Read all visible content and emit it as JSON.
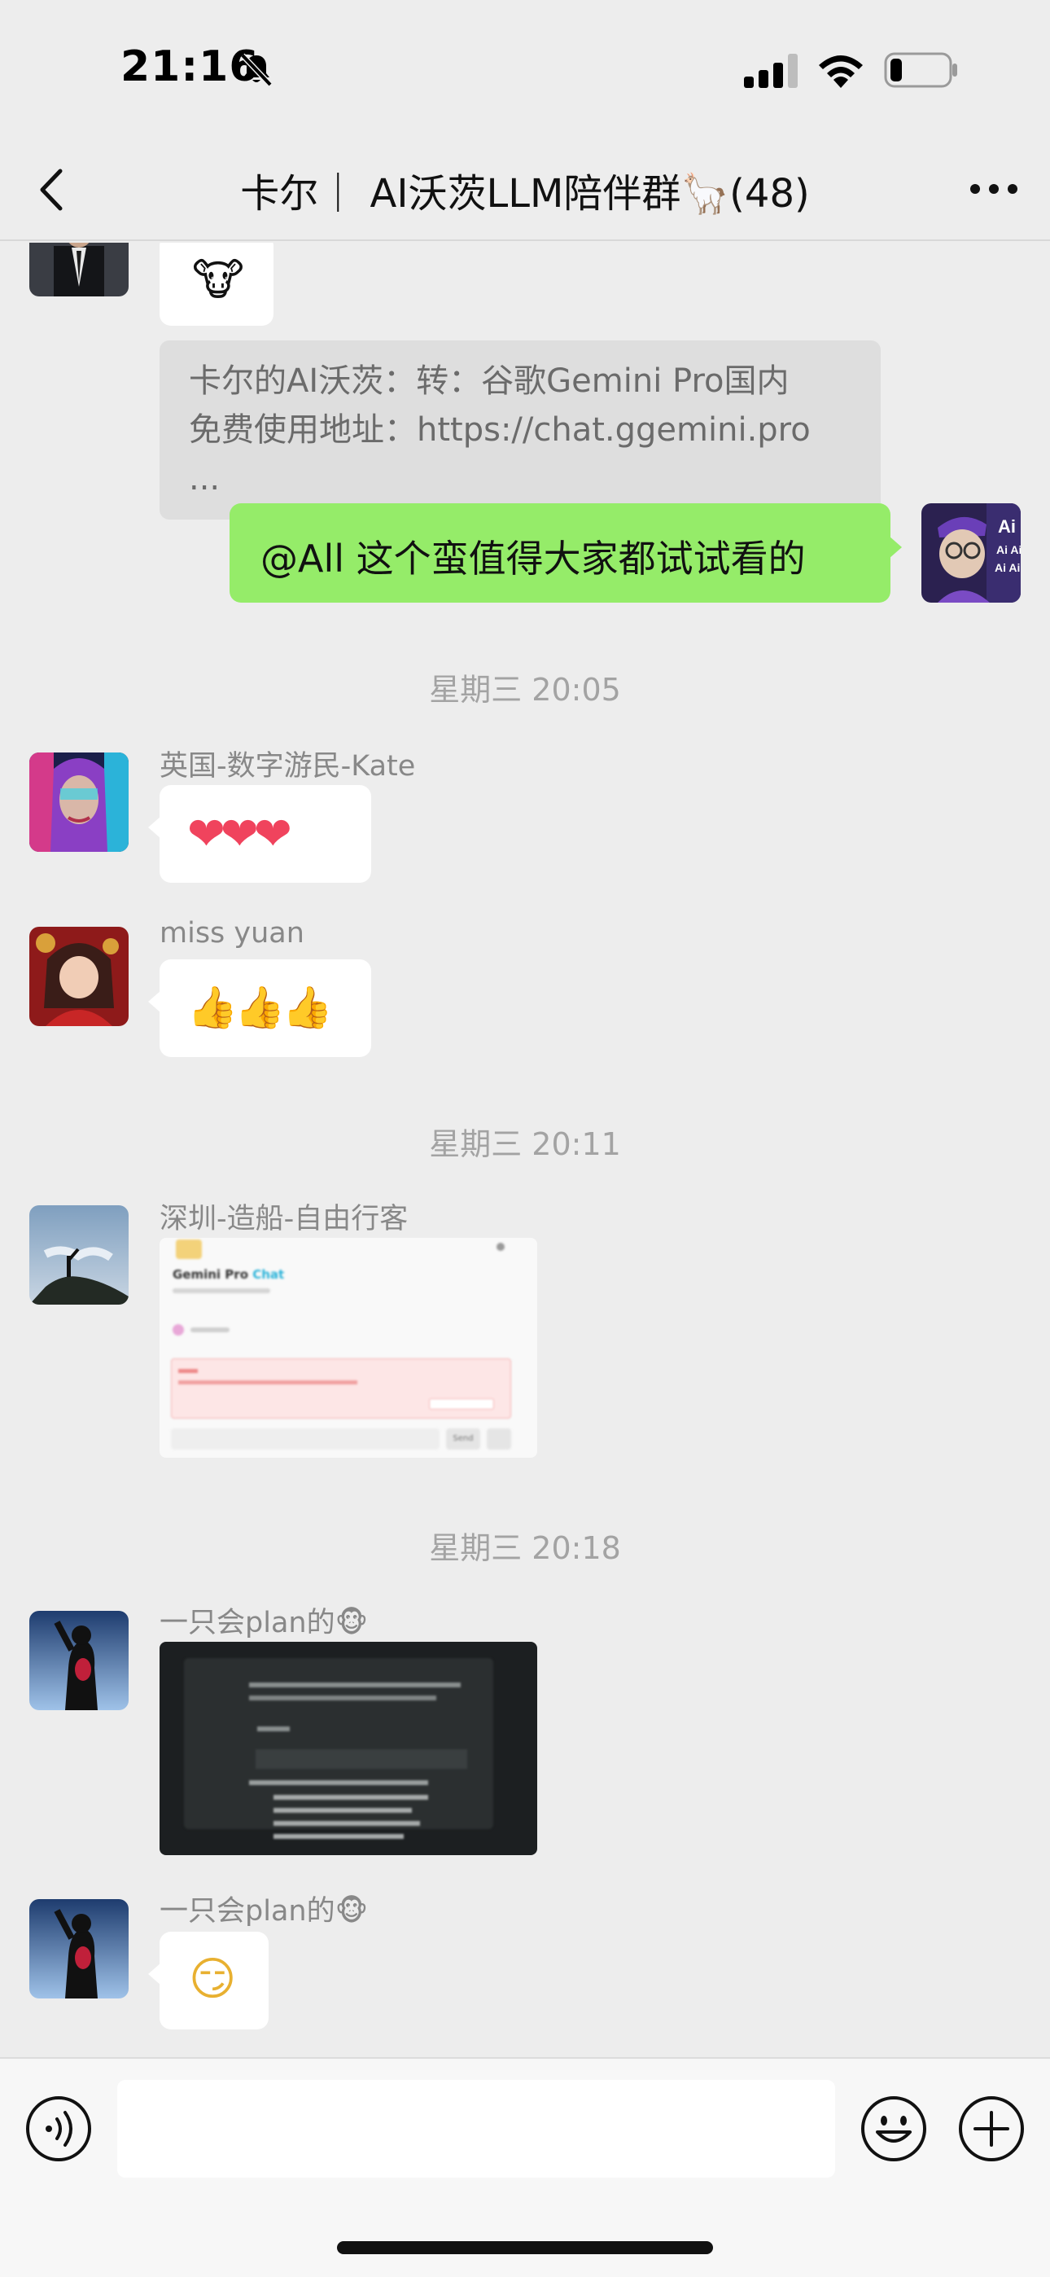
{
  "status_bar": {
    "time": "21:16"
  },
  "nav": {
    "title": "卡尔｜ AI沃茨LLM陪伴群🦙(48)"
  },
  "messages": {
    "first_emoji": "🐮",
    "quote_line1": "卡尔的AI沃茨：转：谷歌Gemini Pro国内",
    "quote_line2": "免费使用地址：https://chat.ggemini.pro ...",
    "self_text": "@All 这个蛮值得大家都试试看的",
    "ts1": "星期三 20:05",
    "kate_name": "英国-数字游民-Kate",
    "kate_msg": "❤❤❤",
    "yuan_name": "miss yuan",
    "yuan_msg": "👍👍👍",
    "ts2": "星期三 20:11",
    "shenzhen_name": "深圳-造船-自由行客",
    "screenshot_title_a": "Gemini Pro",
    "screenshot_title_b": "Chat",
    "screenshot_send": "Send",
    "ts3": "星期三 20:18",
    "plan_name1": "一只会plan的🐵",
    "plan_name2": "一只会plan的🐵",
    "plan_emoji": "😏"
  },
  "colors": {
    "background": "#ededed",
    "self_bubble": "#95ec69",
    "other_bubble": "#ffffff",
    "quote_bg": "#dedede"
  }
}
